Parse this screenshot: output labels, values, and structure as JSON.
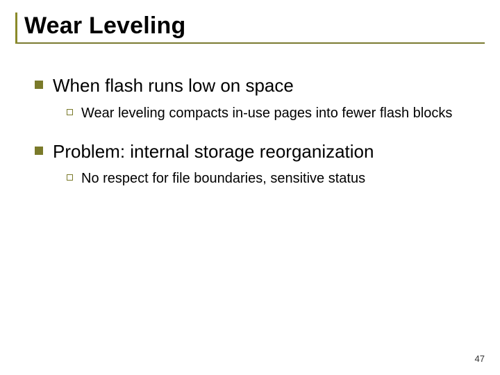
{
  "title": "Wear Leveling",
  "bullets": [
    {
      "text": "When flash runs low on space",
      "sub": [
        "Wear leveling compacts in-use pages into fewer flash blocks"
      ]
    },
    {
      "text": "Problem:  internal storage reorganization",
      "sub": [
        "No respect for file boundaries, sensitive status"
      ]
    }
  ],
  "page_number": "47"
}
